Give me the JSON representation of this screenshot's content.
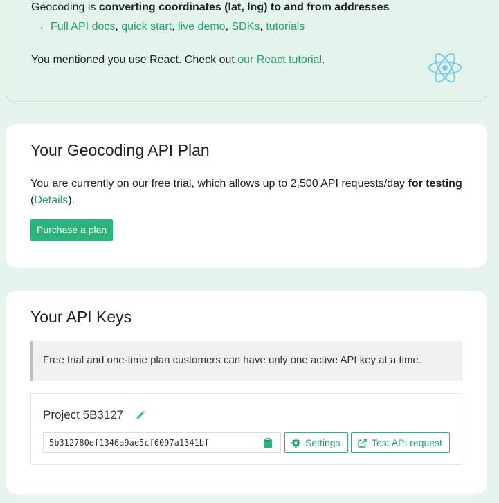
{
  "info": {
    "line1_prefix": "Geocoding is ",
    "line1_bold": "converting coordinates (lat, lng) to and from addresses",
    "arrow": "→",
    "links": [
      "Full API docs",
      "quick start",
      "live demo",
      "SDKs",
      "tutorials"
    ],
    "separator": ", ",
    "line3_prefix": "You mentioned you use React. Check out ",
    "line3_link": "our React tutorial",
    "line3_suffix": ".",
    "logo_icon": "react-logo-icon"
  },
  "plan": {
    "title": "Your Geocoding API Plan",
    "text_prefix": "You are currently on our free trial, which allows up to 2,500 API requests/day ",
    "text_bold": "for testing",
    "paren_open": "(",
    "details_link": "Details",
    "paren_close": ").",
    "purchase_label": "Purchase a plan"
  },
  "keys": {
    "title": "Your API Keys",
    "notice": "Free trial and one-time plan customers can have only one active API key at a time.",
    "project": {
      "name": "Project 5B3127",
      "key": "5b312780ef1346a9ae5cf6097a1341bf",
      "settings_label": "Settings",
      "test_label": "Test API request"
    }
  },
  "colors": {
    "accent": "#27a26f",
    "button": "#2ab37a",
    "page_bg": "#e6f4ec",
    "react": "#7ecbe8"
  }
}
